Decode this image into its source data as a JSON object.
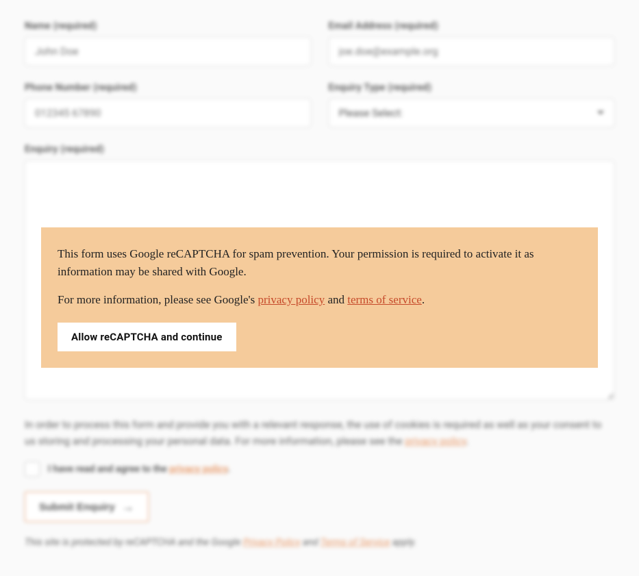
{
  "form": {
    "name": {
      "label": "Name (required)",
      "placeholder": "John Doe"
    },
    "email": {
      "label": "Email Address (required)",
      "placeholder": "joe.doe@example.org"
    },
    "phone": {
      "label": "Phone Number (required)",
      "placeholder": "012345 67890"
    },
    "enquiry_type": {
      "label": "Enquiry Type (required)",
      "selected": "Please Select:"
    },
    "enquiry": {
      "label": "Enquiry (required)"
    },
    "consent_text_1": "In order to process this form and provide you with a relevant response, the use of cookies is required as well as your consent to us storing and processing your personal data. For more information, please see the ",
    "consent_link_1": "privacy policy",
    "consent_text_1b": ".",
    "checkbox_text_1": "I have read and agree to the ",
    "checkbox_link": "privacy policy",
    "checkbox_text_2": ".",
    "submit_label": "Submit Enquiry",
    "recaptcha_note_1": "This site is protected by reCAPTCHA and the Google ",
    "recaptcha_note_link1": "Privacy Policy",
    "recaptcha_note_2": " and ",
    "recaptcha_note_link2": "Terms of Service",
    "recaptcha_note_3": " apply."
  },
  "modal": {
    "p1": "This form uses Google reCAPTCHA for spam prevention. Your permission is required to activate it as information may be shared with Google.",
    "p2_a": "For more information, please see Google's ",
    "p2_link1": "privacy policy",
    "p2_b": " and ",
    "p2_link2": "terms of service",
    "p2_c": ".",
    "button_label": "Allow reCAPTCHA and continue"
  }
}
